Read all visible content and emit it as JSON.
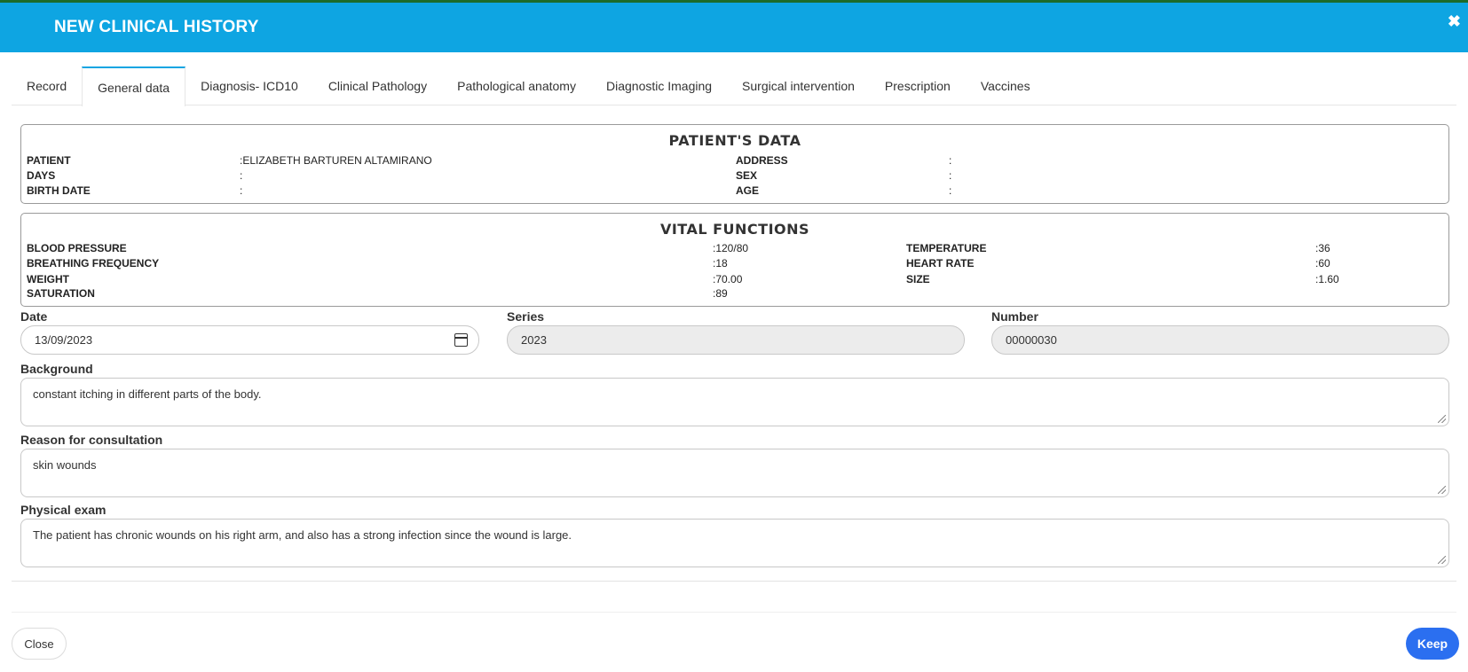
{
  "modal": {
    "title": "NEW CLINICAL HISTORY"
  },
  "tabs": [
    {
      "label": "Record"
    },
    {
      "label": "General data"
    },
    {
      "label": "Diagnosis- ICD10"
    },
    {
      "label": "Clinical Pathology"
    },
    {
      "label": "Pathological anatomy"
    },
    {
      "label": "Diagnostic Imaging"
    },
    {
      "label": "Surgical intervention"
    },
    {
      "label": "Prescription"
    },
    {
      "label": "Vaccines"
    }
  ],
  "active_tab": "General data",
  "patient_data": {
    "title": "PATIENT'S DATA",
    "patient_label": "PATIENT",
    "patient_value": ":ELIZABETH BARTUREN ALTAMIRANO",
    "days_label": "DAYS",
    "days_value": ":",
    "birth_label": "BIRTH DATE",
    "birth_value": ":",
    "address_label": "ADDRESS",
    "address_value": ":",
    "sex_label": "SEX",
    "sex_value": ":",
    "age_label": "AGE",
    "age_value": ":"
  },
  "vital_functions": {
    "title": "VITAL FUNCTIONS",
    "bp_label": "BLOOD PRESSURE",
    "bp_value": ":120/80",
    "bf_label": "BREATHING FREQUENCY",
    "bf_value": ":18",
    "weight_label": "WEIGHT",
    "weight_value": ":70.00",
    "sat_label": "SATURATION",
    "sat_value": ":89",
    "temp_label": "TEMPERATURE",
    "temp_value": ":36",
    "hr_label": "HEART RATE",
    "hr_value": ":60",
    "size_label": "SIZE",
    "size_value": ":1.60"
  },
  "form": {
    "date_label": "Date",
    "date_value": "13/09/2023",
    "series_label": "Series",
    "series_value": "2023",
    "number_label": "Number",
    "number_value": "00000030",
    "background_label": "Background",
    "background_value": "constant itching in different parts of the body.",
    "reason_label": "Reason for consultation",
    "reason_value": "skin wounds",
    "exam_label": "Physical exam",
    "exam_value": "The patient has chronic wounds on his right arm, and also has a strong infection since the wound is large."
  },
  "footer": {
    "close_label": "Close",
    "keep_label": "Keep"
  },
  "colors": {
    "header": "#0ea5e2",
    "keep_button": "#2b6ff0"
  }
}
